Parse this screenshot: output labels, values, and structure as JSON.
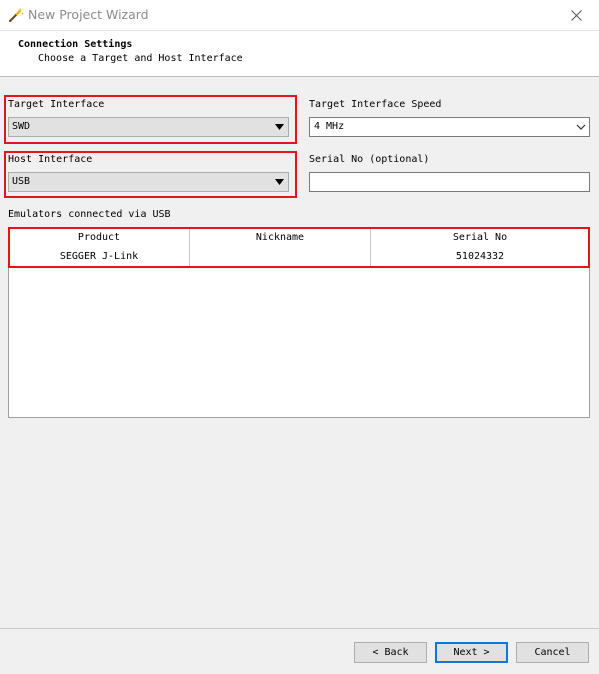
{
  "window": {
    "title": "New Project Wizard",
    "icon": "wand-icon"
  },
  "header": {
    "title": "Connection Settings",
    "subtitle": "Choose a Target and Host Interface"
  },
  "target_interface": {
    "label": "Target Interface",
    "value": "SWD"
  },
  "target_interface_speed": {
    "label": "Target Interface Speed",
    "value": "4 MHz"
  },
  "host_interface": {
    "label": "Host Interface",
    "value": "USB"
  },
  "serial_no": {
    "label": "Serial No (optional)",
    "value": ""
  },
  "emulators": {
    "label": "Emulators connected via USB",
    "columns": [
      "Product",
      "Nickname",
      "Serial No"
    ],
    "rows": [
      [
        "SEGGER J-Link",
        "",
        "51024332"
      ]
    ]
  },
  "buttons": {
    "back": "< Back",
    "next": "Next >",
    "cancel": "Cancel"
  },
  "colors": {
    "highlight": "#e3141b",
    "accent": "#0a78d7"
  }
}
